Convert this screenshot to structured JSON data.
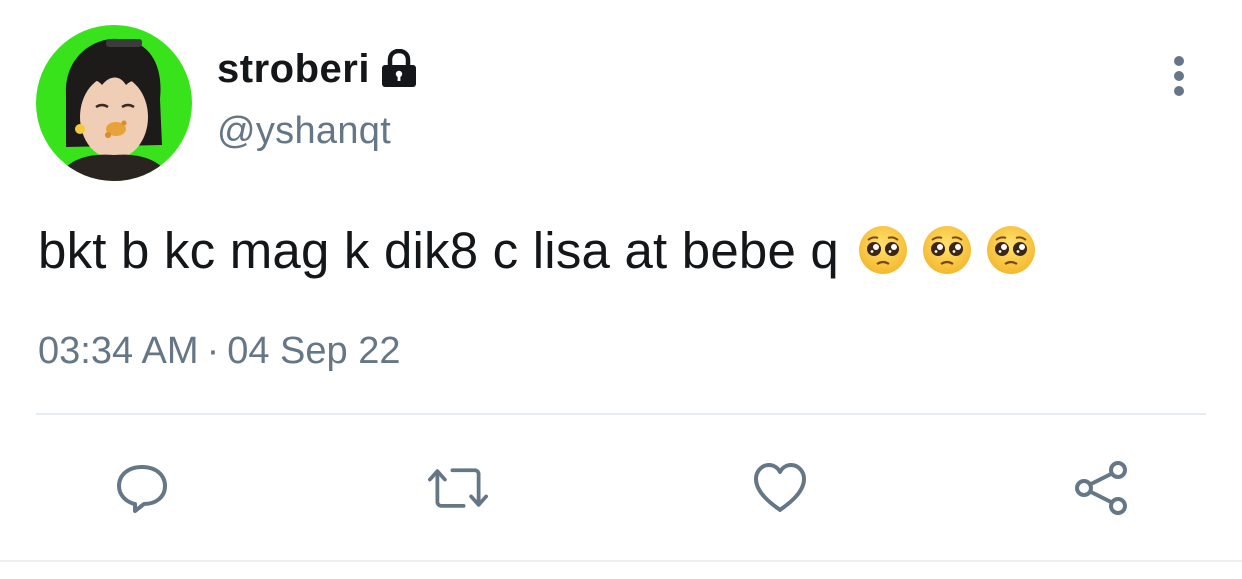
{
  "user": {
    "display_name": "stroberi",
    "handle": "@yshanqt",
    "protected_icon": "lock-icon",
    "avatar_background": "#39e31c"
  },
  "tweet": {
    "text": "bkt b kc mag k dik8 c lisa at bebe q",
    "emojis": [
      "pleading-face",
      "pleading-face",
      "pleading-face"
    ],
    "time": "03:34 AM",
    "separator": "·",
    "date": "04 Sep 22"
  },
  "actions": [
    {
      "name": "reply",
      "icon": "reply-icon"
    },
    {
      "name": "retweet",
      "icon": "retweet-icon"
    },
    {
      "name": "like",
      "icon": "heart-icon"
    },
    {
      "name": "share",
      "icon": "share-icon"
    }
  ],
  "colors": {
    "text": "#14171a",
    "secondary": "#657786",
    "divider": "#e6ecf0"
  }
}
